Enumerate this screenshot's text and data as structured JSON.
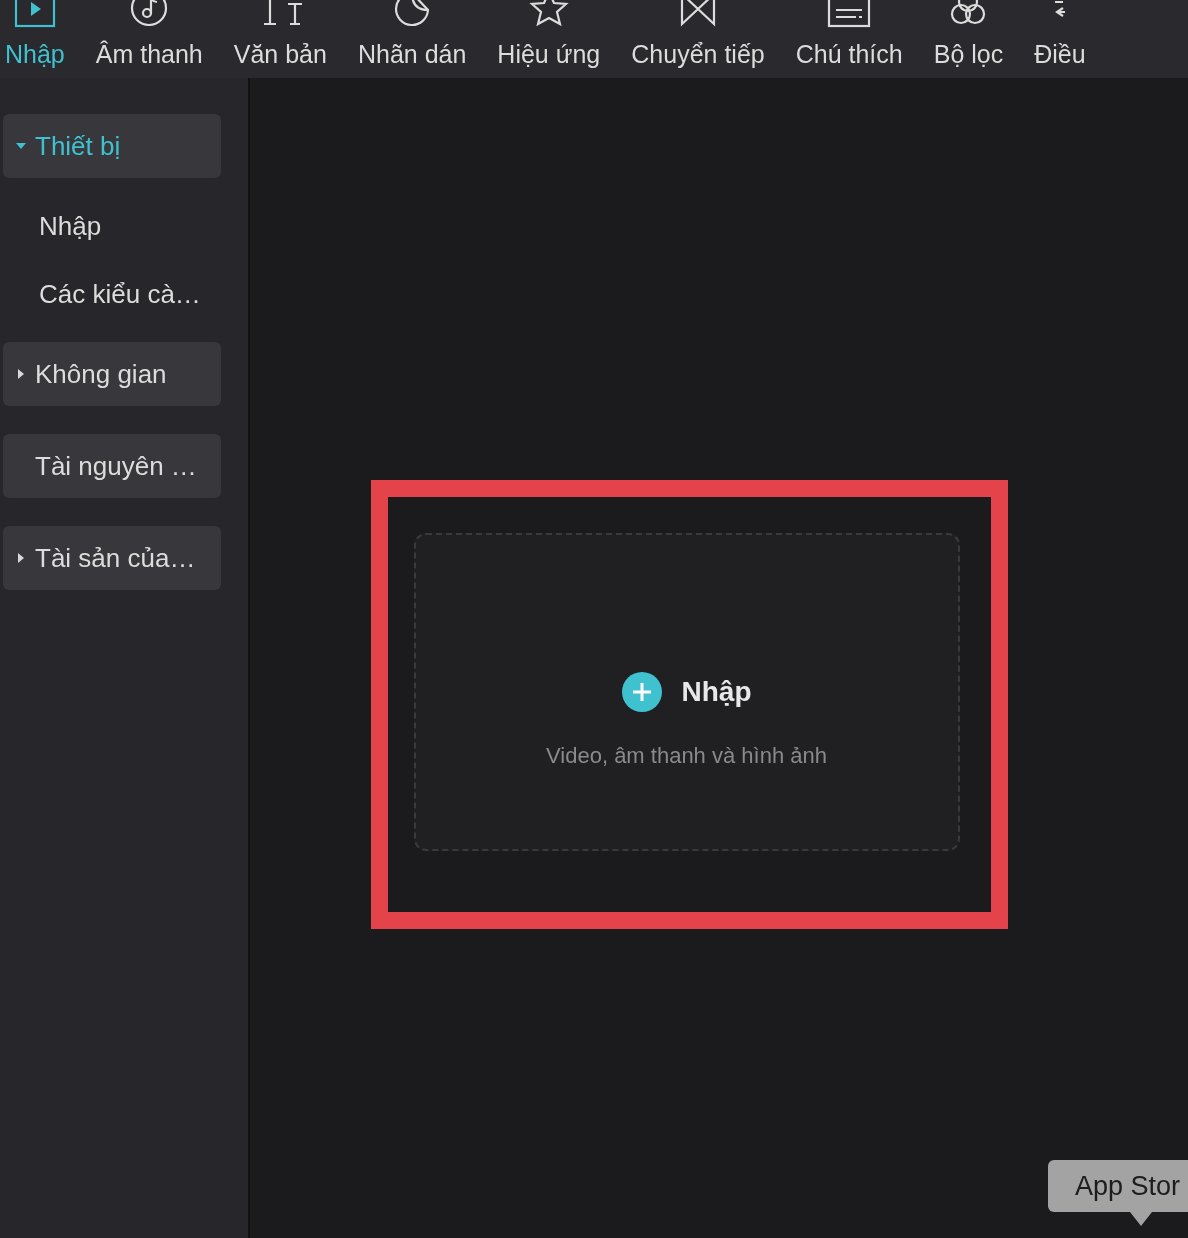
{
  "toolbar": {
    "tabs": [
      {
        "label": "Nhập",
        "selected": true
      },
      {
        "label": "Âm thanh",
        "selected": false
      },
      {
        "label": "Văn bản",
        "selected": false
      },
      {
        "label": "Nhãn dán",
        "selected": false
      },
      {
        "label": "Hiệu ứng",
        "selected": false
      },
      {
        "label": "Chuyển tiếp",
        "selected": false
      },
      {
        "label": "Chú thích",
        "selected": false
      },
      {
        "label": "Bộ lọc",
        "selected": false
      },
      {
        "label": "Điều",
        "selected": false
      }
    ]
  },
  "sidebar": {
    "items": [
      {
        "kind": "group",
        "label": "Thiết bị",
        "expanded": true,
        "selected": true
      },
      {
        "kind": "sub",
        "label": "Nhập"
      },
      {
        "kind": "sub",
        "label": "Các kiểu cà…"
      },
      {
        "kind": "group",
        "label": "Không gian",
        "expanded": false,
        "selected": false
      },
      {
        "kind": "card",
        "label": "Tài nguyên …"
      },
      {
        "kind": "group",
        "label": "Tài sản của…",
        "expanded": false,
        "selected": false
      }
    ]
  },
  "import_area": {
    "highlighted": true,
    "title": "Nhập",
    "subtitle": "Video, âm thanh và hình ảnh"
  },
  "tooltip": {
    "text": "App Stor"
  }
}
